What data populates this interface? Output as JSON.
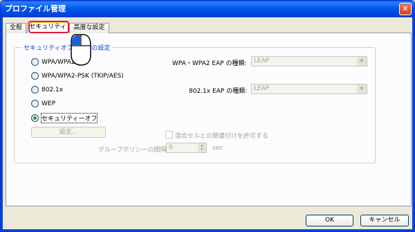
{
  "window": {
    "title": "プロファイル管理",
    "close_glyph": "✕"
  },
  "tabs": [
    {
      "label": "全般"
    },
    {
      "label": "セキュリティ"
    },
    {
      "label": "高度な設定"
    }
  ],
  "group": {
    "legend": "セキュリティオプションの設定"
  },
  "options": [
    {
      "label": "WPA/WPA2",
      "selected": false
    },
    {
      "label": "WPA/WPA2-PSK (TKIP/AES)",
      "selected": false
    },
    {
      "label": "802.1x",
      "selected": false
    },
    {
      "label": "WEP",
      "selected": false
    },
    {
      "label": "セキュリティーオフ",
      "selected": true
    }
  ],
  "settings_button": "設定...",
  "wpa_eap": {
    "label": "WPA・WPA2 EAP の種類:",
    "value": "LEAP"
  },
  "x8021_eap": {
    "label": "802.1x EAP の種類:",
    "value": "LEAP"
  },
  "mixed_cell_checkbox": "混合セルとの関連付けを許可する",
  "group_policy": {
    "label": "グループポリシーの間隔",
    "value": "0",
    "unit": "sec"
  },
  "footer": {
    "ok": "OK",
    "cancel": "キャンセル"
  }
}
